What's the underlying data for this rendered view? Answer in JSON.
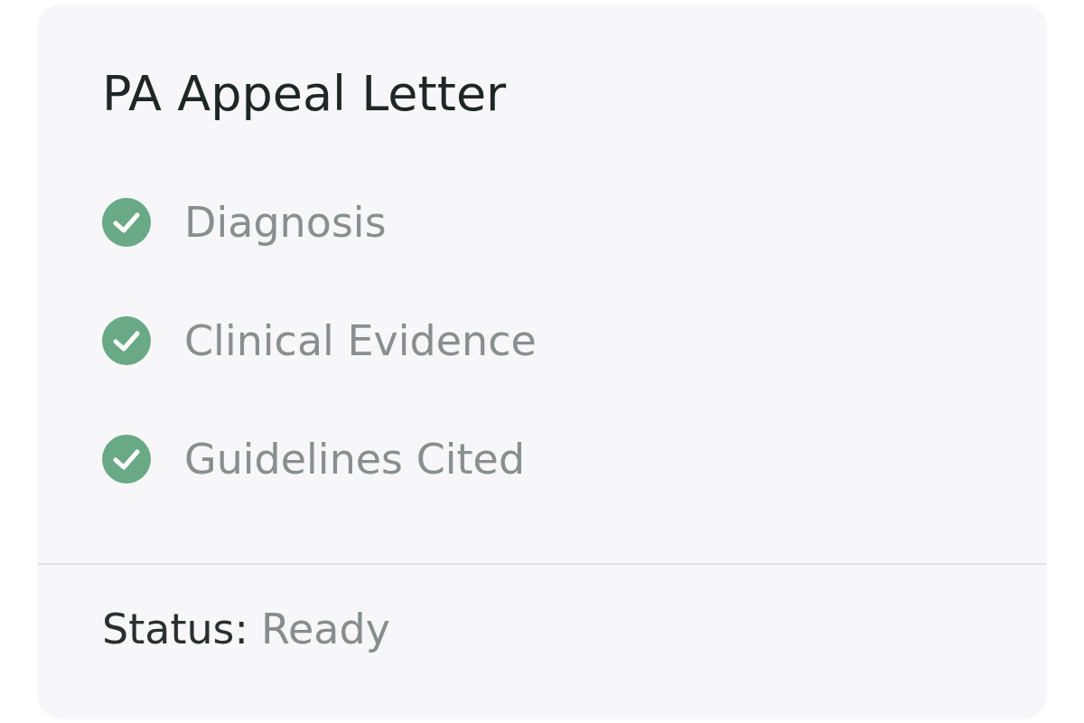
{
  "card": {
    "title": "PA Appeal Letter",
    "checklist": [
      {
        "label": "Diagnosis",
        "checked": true
      },
      {
        "label": "Clinical Evidence",
        "checked": true
      },
      {
        "label": "Guidelines Cited",
        "checked": true
      }
    ],
    "status": {
      "label": "Status:",
      "value": "Ready"
    }
  }
}
